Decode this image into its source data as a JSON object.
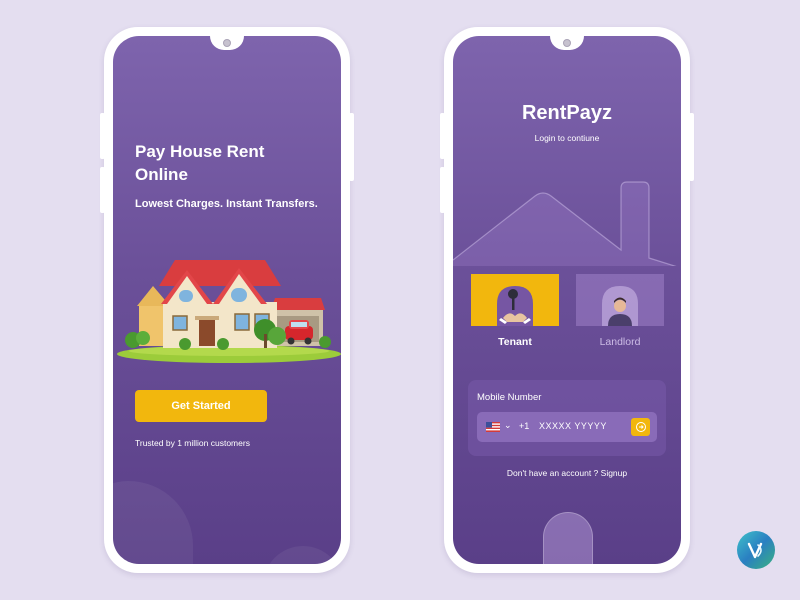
{
  "onboarding": {
    "title": "Pay House Rent Online",
    "subtitle": "Lowest Charges. Instant Transfers.",
    "cta_label": "Get Started",
    "trust_text": "Trusted by 1 million customers"
  },
  "login": {
    "app_name": "RentPayz",
    "subtitle": "Login to contiune",
    "roles": [
      {
        "label": "Tenant",
        "selected": true
      },
      {
        "label": "Landlord",
        "selected": false
      }
    ],
    "mobile_label": "Mobile Number",
    "country_code": "+1",
    "mobile_placeholder": "XXXXX YYYYY",
    "signup_text": "Don't have an account ? Signup"
  },
  "colors": {
    "accent": "#f2b70d",
    "screen_bg": "#6b5099",
    "page_bg": "#e4def0"
  },
  "icons": [
    "house-illustration",
    "us-flag-icon",
    "chevron-down-icon",
    "arrow-right-circle-icon",
    "brand-logo-icon"
  ]
}
